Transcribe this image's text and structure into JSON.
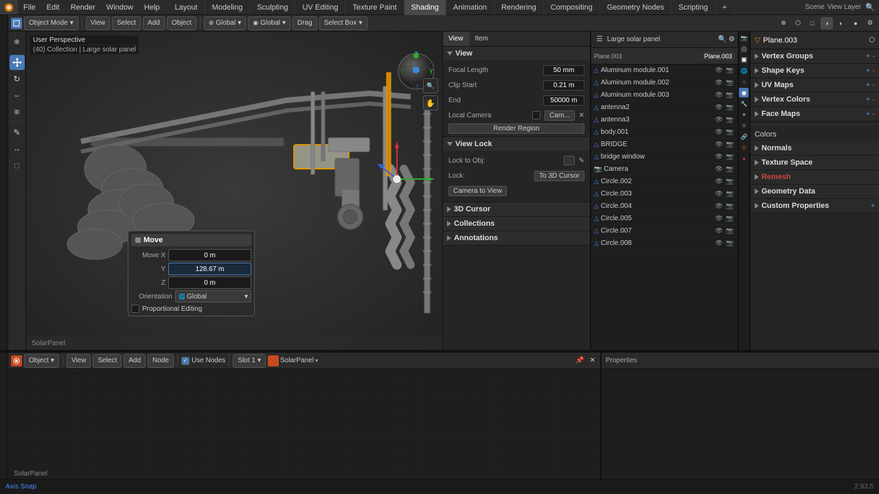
{
  "app": {
    "title": "Blender",
    "version": "2.93",
    "scene_name": "Scene",
    "view_layer": "View Layer"
  },
  "top_menu": {
    "items": [
      "Blender",
      "File",
      "Edit",
      "Render",
      "Window",
      "Help"
    ]
  },
  "workspace_tabs": {
    "tabs": [
      "Layout",
      "Modeling",
      "Sculpting",
      "UV Editing",
      "Texture Paint",
      "Shading",
      "Animation",
      "Rendering",
      "Compositing",
      "Geometry Nodes",
      "Scripting"
    ],
    "active": "Shading",
    "add_icon": "+"
  },
  "viewport_header": {
    "mode": "Object Mode",
    "view_label": "View",
    "select_label": "Select",
    "add_label": "Add",
    "object_label": "Object",
    "orientation": "Global",
    "pivot": "Global",
    "select_box": "Select Box",
    "snap_icon": "magnet",
    "proportional": "proportional-icon"
  },
  "viewport_top_left": {
    "perspective": "User Perspective",
    "collection": "(40) Collection | Large solar panel"
  },
  "move_dialog": {
    "title": "Move",
    "move_x_label": "Move X",
    "x_value": "0 m",
    "y_label": "Y",
    "y_value": "128.67 m",
    "z_label": "Z",
    "z_value": "0 m",
    "orientation_label": "Orientation",
    "orientation_value": "Global",
    "prop_edit_label": "Proportional Editing",
    "prop_edit_checked": false
  },
  "viewport_properties": {
    "view_section": "View",
    "focal_length_label": "Focal Length",
    "focal_length_value": "50 mm",
    "clip_start_label": "Clip Start",
    "clip_start_value": "0.21 m",
    "end_label": "End",
    "end_value": "50000 m",
    "local_camera_label": "Local Camera",
    "camera_name": "Cam...",
    "render_region_label": "Render Region",
    "view_lock_section": "View Lock",
    "lock_to_obj_label": "Lock to Obj:",
    "lock_label": "Lock:",
    "to_3d_cursor": "To 3D Cursor",
    "camera_to_view": "Camera to View",
    "cursor_section": "3D Cursor",
    "collections_section": "Collections",
    "annotations_section": "Annotations"
  },
  "outliner": {
    "title": "Large solar panel",
    "active_object": "Plane.003",
    "items": [
      {
        "name": "Aluminum module.001",
        "type": "mesh",
        "indent": 0,
        "visible": true
      },
      {
        "name": "Aluminum module.002",
        "type": "mesh",
        "indent": 0,
        "visible": true
      },
      {
        "name": "Aluminum module.003",
        "type": "mesh",
        "indent": 0,
        "visible": true
      },
      {
        "name": "antenna2",
        "type": "mesh",
        "indent": 0,
        "visible": true
      },
      {
        "name": "antenna3",
        "type": "mesh",
        "indent": 0,
        "visible": true
      },
      {
        "name": "body.001",
        "type": "mesh",
        "indent": 0,
        "visible": true
      },
      {
        "name": "BRIDGE",
        "type": "mesh",
        "indent": 0,
        "visible": true
      },
      {
        "name": "bridge window",
        "type": "mesh",
        "indent": 0,
        "visible": true
      },
      {
        "name": "Camera",
        "type": "camera",
        "indent": 0,
        "visible": true
      },
      {
        "name": "Circle.002",
        "type": "mesh",
        "indent": 0,
        "visible": true
      },
      {
        "name": "Circle.003",
        "type": "mesh",
        "indent": 0,
        "visible": true
      },
      {
        "name": "Circle.004",
        "type": "mesh",
        "indent": 0,
        "visible": true
      },
      {
        "name": "Circle.005",
        "type": "mesh",
        "indent": 0,
        "visible": true
      },
      {
        "name": "Circle.007",
        "type": "mesh",
        "indent": 0,
        "visible": true
      },
      {
        "name": "Circle.008",
        "type": "mesh",
        "indent": 0,
        "visible": true
      }
    ]
  },
  "properties_panel": {
    "active_section": "mesh",
    "object_name": "Plane.003",
    "sections": [
      {
        "id": "vertex_groups",
        "label": "Vertex Groups"
      },
      {
        "id": "shape_keys",
        "label": "Shape Keys"
      },
      {
        "id": "uv_maps",
        "label": "UV Maps"
      },
      {
        "id": "vertex_colors",
        "label": "Vertex Colors"
      },
      {
        "id": "face_maps",
        "label": "Face Maps"
      },
      {
        "id": "normals",
        "label": "Normals"
      },
      {
        "id": "texture_space",
        "label": "Texture Space"
      },
      {
        "id": "remesh",
        "label": "Remesh"
      },
      {
        "id": "geometry_data",
        "label": "Geometry Data"
      },
      {
        "id": "custom_properties",
        "label": "Custom Properties"
      }
    ],
    "colors_label": "Colors"
  },
  "shader_editor": {
    "header": {
      "mode": "Object",
      "view_label": "View",
      "select_label": "Select",
      "add_label": "Add",
      "node_label": "Node",
      "use_nodes_label": "Use Nodes",
      "use_nodes_checked": true,
      "slot_label": "Slot 1",
      "material_name": "SolarPanel"
    },
    "footer_label": "SolarPanel"
  },
  "status_bar": {
    "axis_snap": "Axis Snap",
    "version": "2.93.5",
    "coords": "2.93.5"
  },
  "viewport_footer": {
    "collection_label": "SolarPanel"
  },
  "colors": {
    "bg_dark": "#1a1a1a",
    "bg_medium": "#252525",
    "bg_panel": "#2a2a2a",
    "accent_blue": "#4a7ab5",
    "axis_x": "#cc3333",
    "axis_y": "#33aa33",
    "axis_z": "#3366cc",
    "selected": "#f0a000"
  }
}
